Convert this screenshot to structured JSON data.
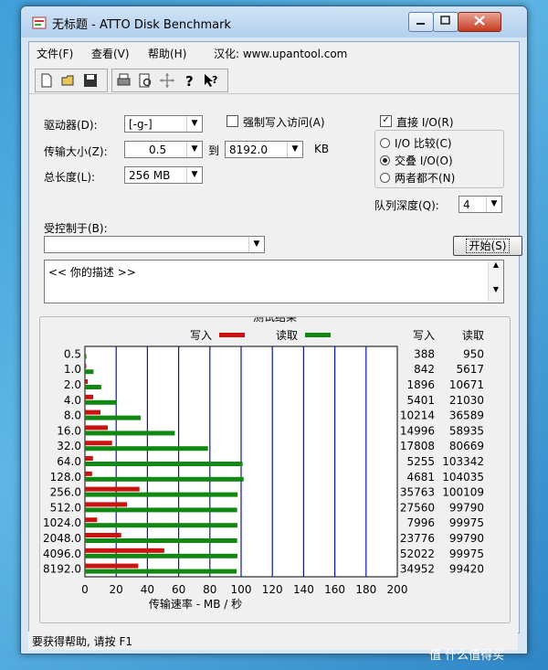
{
  "window": {
    "title": "无标题 - ATTO Disk Benchmark",
    "min_label": "0",
    "max_label": "1",
    "close_label": "r"
  },
  "menu": {
    "file": "文件(F)",
    "view": "查看(V)",
    "help": "帮助(H)",
    "localized": "汉化: www.upantool.com"
  },
  "toolbar": {
    "icons": [
      "new-icon",
      "open-icon",
      "save-icon",
      "print-icon",
      "print-preview-icon",
      "move-icon",
      "help-icon",
      "context-help-icon"
    ]
  },
  "form": {
    "drive_label": "驱动器(D):",
    "drive_value": "[-g-]",
    "force_write_label": "强制写入访问(A)",
    "force_write_checked": false,
    "transfer_label": "传输大小(Z):",
    "transfer_from": "0.5",
    "to_label": "到",
    "transfer_to": "8192.0",
    "unit_label": "KB",
    "length_label": "总长度(L):",
    "length_value": "256 MB",
    "direct_io_label": "直接 I/O(R)",
    "direct_io_checked": true,
    "io_compare_label": "I/O 比较(C)",
    "overlap_io_label": "交叠 I/O(O)",
    "neither_label": "两者都不(N)",
    "queue_label": "队列深度(Q):",
    "queue_value": "4",
    "controlled_label": "受控制于(B):",
    "controlled_value": "",
    "start_label": "开始(S)",
    "description": "<<  你的描述  >>"
  },
  "chart_data": {
    "type": "bar",
    "title": "测试结果",
    "legend_write": "写入",
    "legend_read": "读取",
    "col_write": "写入",
    "col_read": "读取",
    "xlabel": "传输速率 - MB / 秒",
    "xlim": [
      0,
      200
    ],
    "xticks": [
      "0",
      "20",
      "40",
      "60",
      "80",
      "100",
      "120",
      "140",
      "160",
      "180",
      "200"
    ],
    "grid": true,
    "categories": [
      "0.5",
      "1.0",
      "2.0",
      "4.0",
      "8.0",
      "16.0",
      "32.0",
      "64.0",
      "128.0",
      "256.0",
      "512.0",
      "1024.0",
      "2048.0",
      "4096.0",
      "8192.0"
    ],
    "write_kb": [
      "388",
      "842",
      "1896",
      "5401",
      "10214",
      "14996",
      "17808",
      "5255",
      "4681",
      "35763",
      "27560",
      "7996",
      "23776",
      "52022",
      "34952"
    ],
    "read_kb": [
      "950",
      "5617",
      "10671",
      "21030",
      "36589",
      "58935",
      "80669",
      "103342",
      "104035",
      "100109",
      "99790",
      "99975",
      "99790",
      "99975",
      "99420"
    ],
    "colors": {
      "write": "#cc1111",
      "read": "#118811"
    }
  },
  "status": {
    "text": "要获得帮助, 请按 F1"
  },
  "watermark": "值 什么值得买"
}
